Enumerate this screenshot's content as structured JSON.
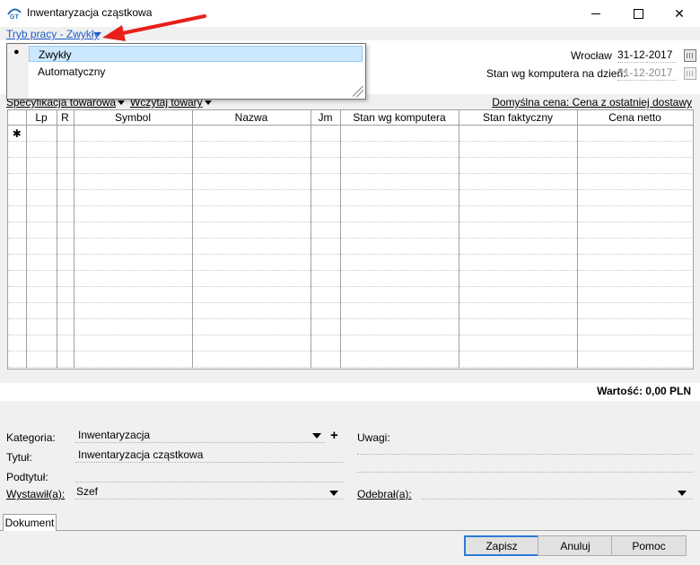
{
  "window": {
    "title": "Inwentaryzacja cząstkowa",
    "minimize": "—",
    "maximize": "☐",
    "close": "✕"
  },
  "mode": {
    "label": "Tryb pracy - Zwykły"
  },
  "mode_menu": {
    "options": [
      "Zwykły",
      "Automatyczny"
    ],
    "selected": "Zwykły",
    "bullet": "●"
  },
  "header": {
    "place": "Wrocław",
    "date": "31-12-2017",
    "stock_date_label": "Stan wg komputera na dzień:",
    "stock_date": "31-12-2017"
  },
  "toolbar": {
    "spec_label": "Specyfikacja towarowa",
    "load_label": "Wczytaj towary",
    "default_price_label": "Domyślna cena: Cena z ostatniej dostawy"
  },
  "grid": {
    "columns": [
      "Lp",
      "R",
      "Symbol",
      "Nazwa",
      "Jm",
      "Stan wg komputera",
      "Stan faktyczny",
      "Cena netto"
    ],
    "new_row_marker": "✱"
  },
  "summary": {
    "value_label": "Wartość: 0,00 PLN"
  },
  "form": {
    "category_label": "Kategoria:",
    "category_value": "Inwentaryzacja",
    "add_symbol": "+",
    "title_label": "Tytuł:",
    "title_value": "Inwentaryzacja cząstkowa",
    "subtitle_label": "Podtytuł:",
    "issued_by_label": "Wystawił(a):",
    "issued_by_value": "Szef",
    "notes_label": "Uwagi:",
    "received_by_label": "Odebrał(a):"
  },
  "tabs": {
    "document": "Dokument"
  },
  "buttons": {
    "save": "Zapisz",
    "cancel": "Anuluj",
    "help": "Pomoc"
  },
  "colors": {
    "link": "#1f5cc7",
    "selection": "#cce8ff",
    "annotation_arrow": "#e8201a"
  }
}
